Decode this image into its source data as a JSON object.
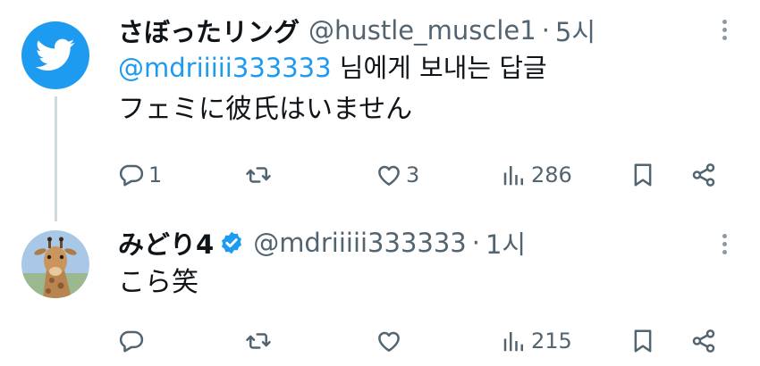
{
  "tweets": [
    {
      "name": "さぼったリング",
      "handle": "@hustle_muscle1",
      "separator": "·",
      "time": "5시",
      "reply_mention": "@mdriiiii333333",
      "reply_suffix": " 님에게 보내는 답글",
      "text": "フェミに彼氏はいません",
      "counts": {
        "replies": "1",
        "retweets": "",
        "likes": "3",
        "views": "286"
      }
    },
    {
      "name": "みどり4",
      "handle": "@mdriiiii333333",
      "separator": "·",
      "time": "1시",
      "text": "こら笑",
      "counts": {
        "replies": "",
        "retweets": "",
        "likes": "",
        "views": "215"
      }
    }
  ],
  "colors": {
    "accent": "#1d9bf0",
    "text": "#0f1419",
    "secondary": "#536471",
    "thread_line": "#cfd9de"
  },
  "icons": [
    "twitter-bird-icon",
    "verified-badge-icon",
    "reply-icon",
    "retweet-icon",
    "like-icon",
    "views-icon",
    "bookmark-icon",
    "share-icon",
    "more-options-icon"
  ]
}
